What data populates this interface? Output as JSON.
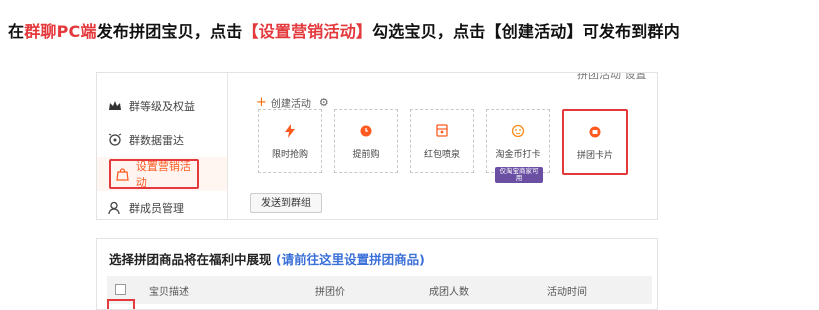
{
  "headline": {
    "p1": "在",
    "p2": "群聊PC端",
    "p3": "发布拼团宝贝，点击",
    "p4": "【设置营销活动】",
    "p5": "勾选宝贝，点击【创建活动】可发布到群内"
  },
  "top_panel": {
    "cropped_text": "拼团活动 设置",
    "sidebar": [
      {
        "label": "群等级及权益",
        "icon": "crown-icon"
      },
      {
        "label": "群数据雷达",
        "icon": "radar-icon"
      },
      {
        "label": "设置营销活动",
        "icon": "bag-icon",
        "active": true
      },
      {
        "label": "群成员管理",
        "icon": "user-icon"
      }
    ],
    "create_label": "创建活动",
    "activities": [
      {
        "label": "限时抢购",
        "icon": "lightning-icon"
      },
      {
        "label": "提前购",
        "icon": "clock-icon"
      },
      {
        "label": "红包喷泉",
        "icon": "gift-icon"
      },
      {
        "label": "淘金币打卡",
        "icon": "coin-icon"
      },
      {
        "label": "拼团卡片",
        "icon": "group-icon"
      }
    ],
    "badge_text": "仅淘宝商家可用",
    "send_button": "发送到群组"
  },
  "bottom_panel": {
    "title": "选择拼团商品将在福利中展现",
    "title_link": "(请前往这里设置拼团商品)",
    "columns": [
      "宝贝描述",
      "拼团价",
      "成团人数",
      "活动时间"
    ]
  },
  "colors": {
    "accent": "#e4393c",
    "orange": "#ff6a00",
    "link": "#3a6fd8",
    "badge": "#6a4fa3"
  }
}
